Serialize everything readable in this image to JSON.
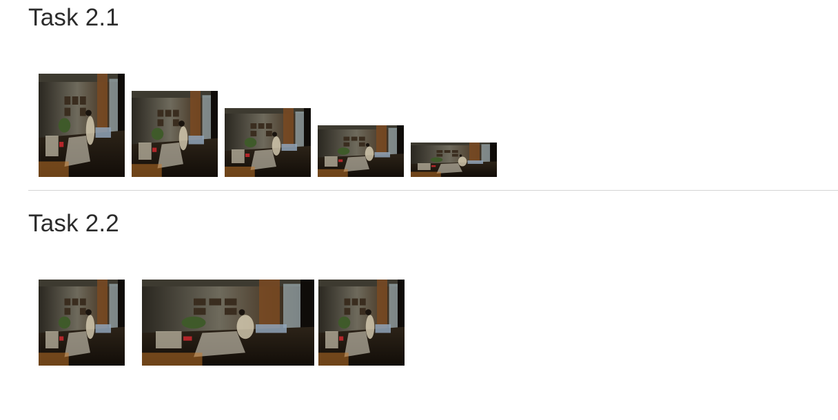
{
  "sections": [
    {
      "title": "Task 2.1",
      "images": [
        {
          "alt": "Sunlit living room photo"
        },
        {
          "alt": "Sunlit living room photo"
        },
        {
          "alt": "Sunlit living room photo"
        },
        {
          "alt": "Sunlit living room photo"
        },
        {
          "alt": "Sunlit living room photo"
        }
      ]
    },
    {
      "title": "Task 2.2",
      "images": [
        {
          "alt": "Sunlit living room photo"
        },
        {
          "alt": "Sunlit living room photo"
        },
        {
          "alt": "Sunlit living room photo"
        }
      ]
    }
  ],
  "colors": {
    "heading": "#2b2b2b",
    "divider": "#d4d4d4",
    "photo_dark": "#15120d",
    "photo_wall": "#6e6a5c",
    "photo_wood": "#7a4a22",
    "photo_light": "#e8e2cf",
    "photo_sofa": "#8fa3b8",
    "photo_red": "#b3262a"
  }
}
